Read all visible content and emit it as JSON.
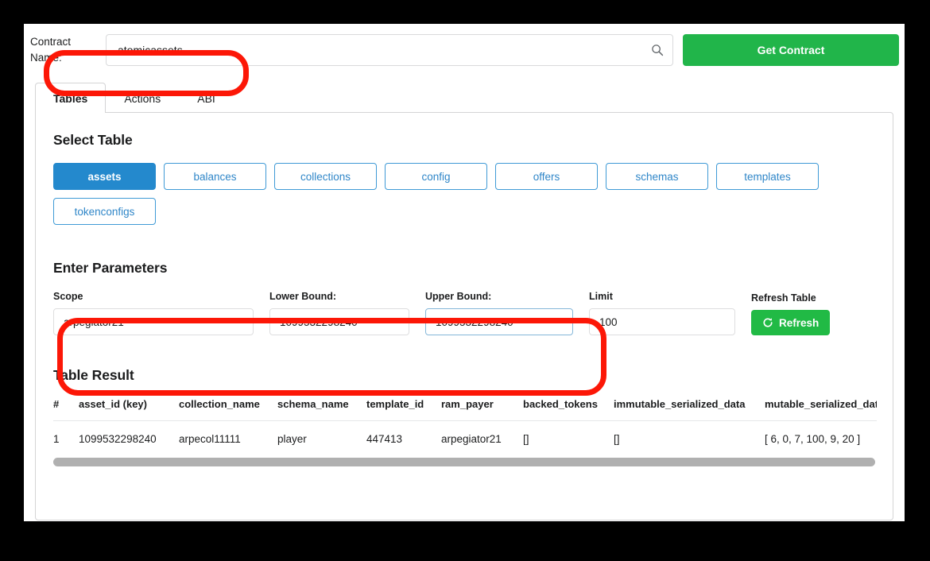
{
  "top_bar": {
    "contract_name_label": "Contract Name:",
    "contract_name_value": "atomicassets",
    "contract_name_placeholder": "",
    "search_icon": "search-icon",
    "get_contract_label": "Get Contract",
    "get_contract_color": "#21b54a"
  },
  "tabs": [
    {
      "label": "Tables",
      "active": true
    },
    {
      "label": "Actions",
      "active": false
    },
    {
      "label": "ABI",
      "active": false
    }
  ],
  "select_table": {
    "heading": "Select Table",
    "selected": "assets",
    "selected_color": "#2489cd",
    "chip_color": "#2f86c8",
    "chips": [
      "assets",
      "balances",
      "collections",
      "config",
      "offers",
      "schemas",
      "templates",
      "tokenconfigs"
    ]
  },
  "parameters": {
    "heading": "Enter Parameters",
    "fields": [
      {
        "label": "Scope",
        "value": "arpegiator21",
        "focused": false
      },
      {
        "label": "Lower Bound:",
        "value": "1099532298240",
        "focused": false
      },
      {
        "label": "Upper Bound:",
        "value": "1099532298240",
        "focused": true
      },
      {
        "label": "Limit",
        "value": "100",
        "focused": false
      }
    ],
    "refresh_label": "Refresh Table",
    "refresh_button_label": "Refresh",
    "refresh_icon": "refresh-icon",
    "refresh_color": "#21ba45"
  },
  "table_result": {
    "heading": "Table Result",
    "columns": [
      "#",
      "asset_id (key)",
      "collection_name",
      "schema_name",
      "template_id",
      "ram_payer",
      "backed_tokens",
      "immutable_serialized_data",
      "mutable_serialized_data"
    ],
    "rows": [
      [
        "1",
        "1099532298240",
        "arpecol11111",
        "player",
        "447413",
        "arpegiator21",
        "[]",
        "[]",
        "[ 6, 0, 7, 100, 9, 20 ]"
      ]
    ],
    "scrollbar_color": "#b0b0b0"
  },
  "annotations": {
    "color": "#fc1707",
    "boxes": [
      {
        "name": "contract-name-highlight"
      },
      {
        "name": "parameters-highlight"
      }
    ]
  }
}
